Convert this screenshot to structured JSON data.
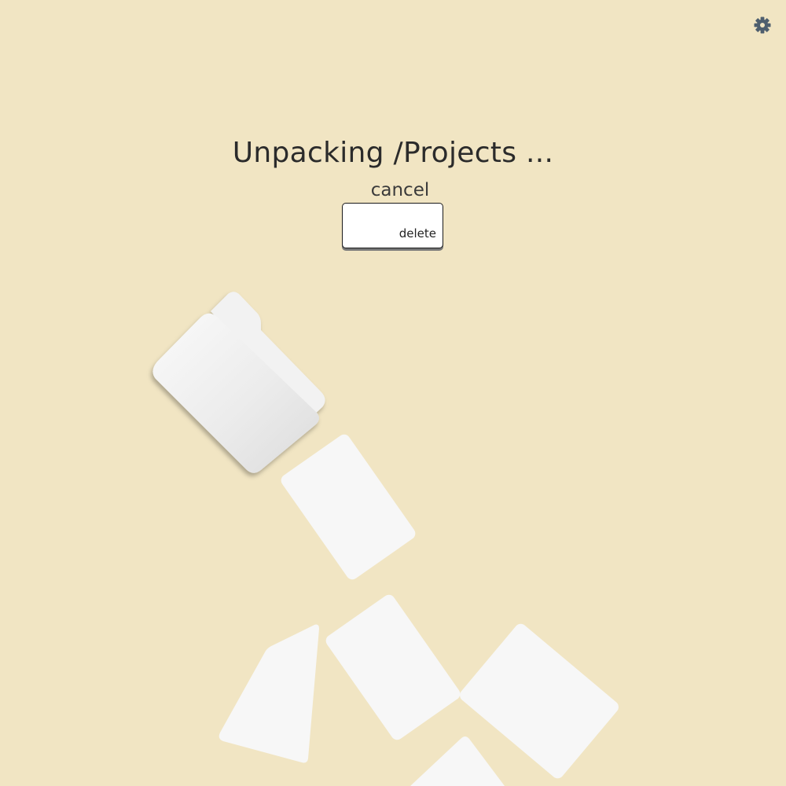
{
  "title": "Unpacking /Projects ...",
  "cancel_label": "cancel",
  "delete_key_label": "delete",
  "icons": {
    "settings": "gear-icon",
    "folder": "folder-icon",
    "card": "file-card"
  },
  "colors": {
    "background": "#f1e5c3",
    "card": "#f7f7f7",
    "text": "#2b2b2b",
    "gear": "#4e5e6e"
  }
}
